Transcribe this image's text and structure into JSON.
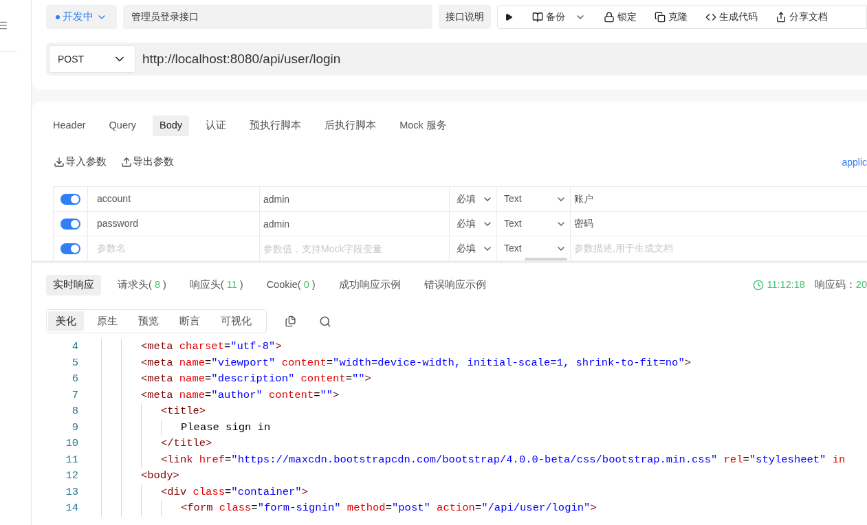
{
  "top_bar": {
    "status": "开发中",
    "name": "管理员登录接口",
    "doc_button": "接口说明",
    "actions": [
      {
        "kind": "run"
      },
      {
        "kind": "backup",
        "label": "备份",
        "dropdown": true
      },
      {
        "kind": "lock",
        "label": "锁定"
      },
      {
        "kind": "clone",
        "label": "克隆"
      },
      {
        "kind": "code",
        "label": "生成代码"
      },
      {
        "kind": "share",
        "label": "分享文档"
      }
    ]
  },
  "request": {
    "method": "POST",
    "url": "http://localhost:8080/api/user/login"
  },
  "tabs": [
    {
      "label": "Header",
      "selected": false
    },
    {
      "label": "Query",
      "selected": false
    },
    {
      "label": "Body",
      "selected": true
    },
    {
      "label": "认证",
      "selected": false
    },
    {
      "label": "预执行脚本",
      "selected": false
    },
    {
      "label": "后执行脚本",
      "selected": false
    },
    {
      "label": "Mock 服务",
      "selected": false
    }
  ],
  "param_actions": [
    {
      "kind": "import",
      "label": "导入参数"
    },
    {
      "kind": "export",
      "label": "导出参数"
    }
  ],
  "content_type": "applic",
  "params": [
    {
      "enabled": true,
      "name": "account",
      "value": "admin",
      "required": "必填",
      "type": "Text",
      "description": "账户"
    },
    {
      "enabled": true,
      "name": "password",
      "value": "admin",
      "required": "必填",
      "type": "Text",
      "description": "密码"
    },
    {
      "enabled": true,
      "name_placeholder": "参数名",
      "value_placeholder": "参数值，支持Mock字段变量",
      "required": "必填",
      "type": "Text",
      "description_placeholder": "参数描述,用于生成文档"
    }
  ],
  "response_tabs": [
    {
      "label": "实时响应",
      "selected": true
    },
    {
      "label": "请求头(",
      "count": "8",
      "close": ")",
      "selected": false
    },
    {
      "label": "响应头(",
      "count": "11",
      "close": ")",
      "selected": false
    },
    {
      "label": "Cookie(",
      "count": "0",
      "close": ")",
      "selected": false
    },
    {
      "label": "成功响应示例",
      "selected": false
    },
    {
      "label": "错误响应示例",
      "selected": false
    }
  ],
  "response_meta": {
    "time": "11:12:18",
    "code_label": "响应码：",
    "code": "20"
  },
  "view_tabs": [
    {
      "label": "美化",
      "selected": true
    },
    {
      "label": "原生",
      "selected": false
    },
    {
      "label": "预览",
      "selected": false
    },
    {
      "label": "断言",
      "selected": false
    },
    {
      "label": "可视化",
      "selected": false
    }
  ],
  "code_lines": [
    {
      "number": "4",
      "tokens": [
        {
          "kind": "tag",
          "text": "<meta"
        },
        {
          "kind": "attr",
          "text": " charset"
        },
        {
          "kind": "punct",
          "text": "="
        },
        {
          "kind": "str",
          "text": "\"utf-8\""
        },
        {
          "kind": "tag",
          "text": ">"
        }
      ]
    },
    {
      "number": "5",
      "tokens": [
        {
          "kind": "tag",
          "text": "<meta"
        },
        {
          "kind": "attr",
          "text": " name"
        },
        {
          "kind": "punct",
          "text": "="
        },
        {
          "kind": "str",
          "text": "\"viewport\""
        },
        {
          "kind": "attr",
          "text": " content"
        },
        {
          "kind": "punct",
          "text": "="
        },
        {
          "kind": "str",
          "text": "\"width=device-width, initial-scale=1, shrink-to-fit=no\""
        },
        {
          "kind": "tag",
          "text": ">"
        }
      ]
    },
    {
      "number": "6",
      "tokens": [
        {
          "kind": "tag",
          "text": "<meta"
        },
        {
          "kind": "attr",
          "text": " name"
        },
        {
          "kind": "punct",
          "text": "="
        },
        {
          "kind": "str",
          "text": "\"description\""
        },
        {
          "kind": "attr",
          "text": " content"
        },
        {
          "kind": "punct",
          "text": "="
        },
        {
          "kind": "str",
          "text": "\"\""
        },
        {
          "kind": "tag",
          "text": ">"
        }
      ]
    },
    {
      "number": "7",
      "tokens": [
        {
          "kind": "tag",
          "text": "<meta"
        },
        {
          "kind": "attr",
          "text": " name"
        },
        {
          "kind": "punct",
          "text": "="
        },
        {
          "kind": "str",
          "text": "\"author\""
        },
        {
          "kind": "attr",
          "text": " content"
        },
        {
          "kind": "punct",
          "text": "="
        },
        {
          "kind": "str",
          "text": "\"\""
        },
        {
          "kind": "tag",
          "text": ">"
        }
      ],
      "children": [
        {
          "number": "8",
          "tokens": [
            {
              "kind": "tag",
              "text": "<title>"
            }
          ],
          "children": [
            {
              "number": "9",
              "tokens": [
                {
                  "kind": "text",
                  "text": "Please sign in"
                }
              ]
            }
          ]
        },
        {
          "number": "10",
          "tokens": [
            {
              "kind": "tag",
              "text": "</title>"
            }
          ]
        },
        {
          "number": "11",
          "tokens": [
            {
              "kind": "tag",
              "text": "<link"
            },
            {
              "kind": "attr",
              "text": " href"
            },
            {
              "kind": "punct",
              "text": "="
            },
            {
              "kind": "str",
              "text": "\"https://maxcdn.bootstrapcdn.com/bootstrap/4.0.0-beta/css/bootstrap.min.css\""
            },
            {
              "kind": "attr",
              "text": " rel"
            },
            {
              "kind": "punct",
              "text": "="
            },
            {
              "kind": "str",
              "text": "\"stylesheet\""
            },
            {
              "kind": "attr",
              "text": " in"
            }
          ]
        }
      ]
    },
    {
      "number": "12",
      "tokens": [
        {
          "kind": "tag",
          "text": "<body>"
        }
      ],
      "children": [
        {
          "number": "13",
          "tokens": [
            {
              "kind": "tag",
              "text": "<div"
            },
            {
              "kind": "attr",
              "text": " class"
            },
            {
              "kind": "punct",
              "text": "="
            },
            {
              "kind": "str",
              "text": "\"container\""
            },
            {
              "kind": "tag",
              "text": ">"
            }
          ],
          "children": [
            {
              "number": "14",
              "tokens": [
                {
                  "kind": "tag",
                  "text": "<form"
                },
                {
                  "kind": "attr",
                  "text": " class"
                },
                {
                  "kind": "punct",
                  "text": "="
                },
                {
                  "kind": "str",
                  "text": "\"form-signin\""
                },
                {
                  "kind": "attr",
                  "text": " method"
                },
                {
                  "kind": "punct",
                  "text": "="
                },
                {
                  "kind": "str",
                  "text": "\"post\""
                },
                {
                  "kind": "attr",
                  "text": " action"
                },
                {
                  "kind": "punct",
                  "text": "="
                },
                {
                  "kind": "str",
                  "text": "\"/api/user/login\""
                },
                {
                  "kind": "tag",
                  "text": ">"
                }
              ]
            }
          ]
        }
      ]
    }
  ]
}
